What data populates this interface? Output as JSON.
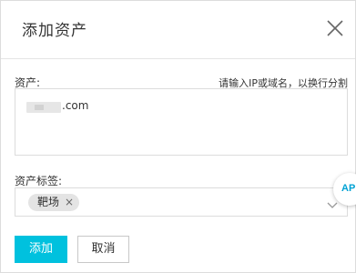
{
  "dialog": {
    "title": "添加资产",
    "close_icon": "close-icon"
  },
  "assets": {
    "label": "资产:",
    "hint": "请输入IP或域名，以换行分割",
    "value_suffix": ".com"
  },
  "tags": {
    "label": "资产标签:",
    "selected": [
      "靶场"
    ],
    "remove_icon": "×",
    "dropdown_icon": "chevron-down-icon"
  },
  "floating_badge": {
    "text": "AP"
  },
  "footer": {
    "confirm_label": "添加",
    "cancel_label": "取消"
  },
  "colors": {
    "primary": "#00c1de",
    "border": "#dcdcdc",
    "tag_bg": "#e4e4e4"
  }
}
